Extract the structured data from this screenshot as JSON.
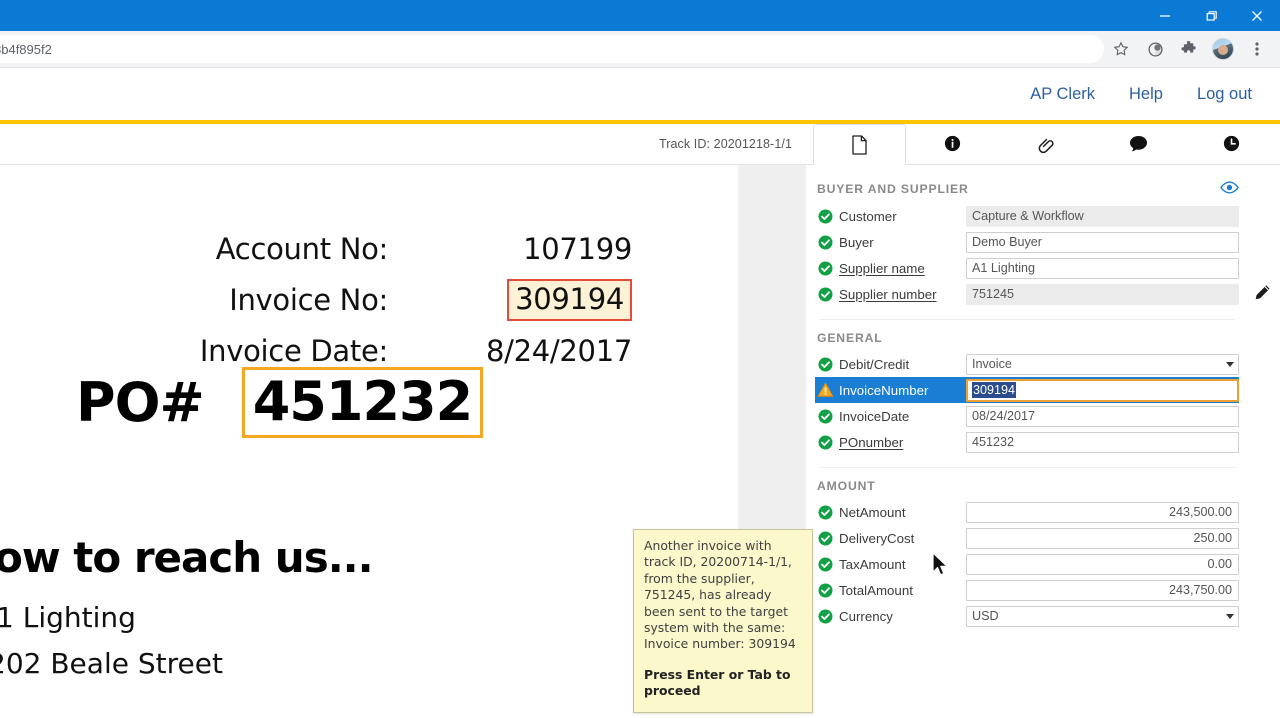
{
  "browser": {
    "url_text": "8b4f895f2",
    "window_controls": [
      "minimize",
      "restore",
      "close"
    ],
    "toolbar_icons": [
      "bookmark-star-icon",
      "profile-circle-icon",
      "extensions-puzzle-icon",
      "account-avatar",
      "browser-menu-icon"
    ]
  },
  "app_header": {
    "links": [
      {
        "label": "AP Clerk",
        "name": "ap-clerk-link"
      },
      {
        "label": "Help",
        "name": "help-link"
      },
      {
        "label": "Log out",
        "name": "logout-link"
      }
    ],
    "accent_color": "#fdc400"
  },
  "document_pane": {
    "track_id": "Track ID: 20201218-1/1",
    "invoice": {
      "rows": [
        {
          "label": "Account No:",
          "value": "107199",
          "highlight": "none"
        },
        {
          "label": "Invoice No:",
          "value": "309194",
          "highlight": "red"
        },
        {
          "label": "Invoice Date:",
          "value": "8/24/2017",
          "highlight": "none"
        }
      ],
      "po_label": "PO#",
      "po_value": "451232",
      "footer_heading": "ow to reach us...",
      "footer_line1": "1 Lighting",
      "footer_line2": "202 Beale Street"
    }
  },
  "tooltip": {
    "body": "Another invoice with track ID, 20200714-1/1, from the supplier, 751245, has already been sent to the target system with the same:\nInvoice number: 309194",
    "action": "Press Enter or Tab to proceed",
    "background": "#fbf8cc"
  },
  "side_panel": {
    "tabs": [
      {
        "icon": "document-icon",
        "name": "tab-document",
        "active": true
      },
      {
        "icon": "info-icon",
        "name": "tab-info",
        "active": false
      },
      {
        "icon": "attachment-link-icon",
        "name": "tab-attachments",
        "active": false
      },
      {
        "icon": "comment-icon",
        "name": "tab-comments",
        "active": false
      },
      {
        "icon": "history-clock-icon",
        "name": "tab-history",
        "active": false
      }
    ],
    "sections": [
      {
        "title": "BUYER AND SUPPLIER",
        "action_icon": "eye-icon",
        "fields": [
          {
            "status": "ok",
            "label": "Customer",
            "value": "Capture & Workflow",
            "type": "readonly",
            "link": false
          },
          {
            "status": "ok",
            "label": "Buyer",
            "value": "Demo Buyer",
            "type": "text",
            "link": false
          },
          {
            "status": "ok",
            "label": "Supplier name",
            "value": "A1 Lighting",
            "type": "text",
            "link": true
          },
          {
            "status": "ok",
            "label": "Supplier number",
            "value": "751245",
            "type": "readonly",
            "link": true
          }
        ]
      },
      {
        "title": "GENERAL",
        "fields": [
          {
            "status": "ok",
            "label": "Debit/Credit",
            "value": "Invoice",
            "type": "select",
            "link": false
          },
          {
            "status": "warning",
            "label": "InvoiceNumber",
            "value": "309194",
            "type": "text",
            "link": false,
            "selected": true,
            "text_selected": true
          },
          {
            "status": "ok",
            "label": "InvoiceDate",
            "value": "08/24/2017",
            "type": "text",
            "link": false
          },
          {
            "status": "ok",
            "label": "POnumber",
            "value": "451232",
            "type": "text",
            "link": true
          }
        ]
      },
      {
        "title": "AMOUNT",
        "fields": [
          {
            "status": "ok",
            "label": "NetAmount",
            "value": "243,500.00",
            "type": "number",
            "link": false
          },
          {
            "status": "ok",
            "label": "DeliveryCost",
            "value": "250.00",
            "type": "number",
            "link": false
          },
          {
            "status": "ok",
            "label": "TaxAmount",
            "value": "0.00",
            "type": "number",
            "link": false
          },
          {
            "status": "ok",
            "label": "TotalAmount",
            "value": "243,750.00",
            "type": "number",
            "link": false
          },
          {
            "status": "ok",
            "label": "Currency",
            "value": "USD",
            "type": "select",
            "link": false
          }
        ]
      }
    ],
    "edit_icon": "pencil-edit-icon"
  },
  "colors": {
    "titlebar_blue": "#0b7ad4",
    "accent_yellow": "#fdc400",
    "status_ok_green": "#12a046",
    "status_warning_orange": "#f5a623",
    "row_highlight_blue": "#1a7fd4",
    "link_blue": "#2c5f9e"
  }
}
